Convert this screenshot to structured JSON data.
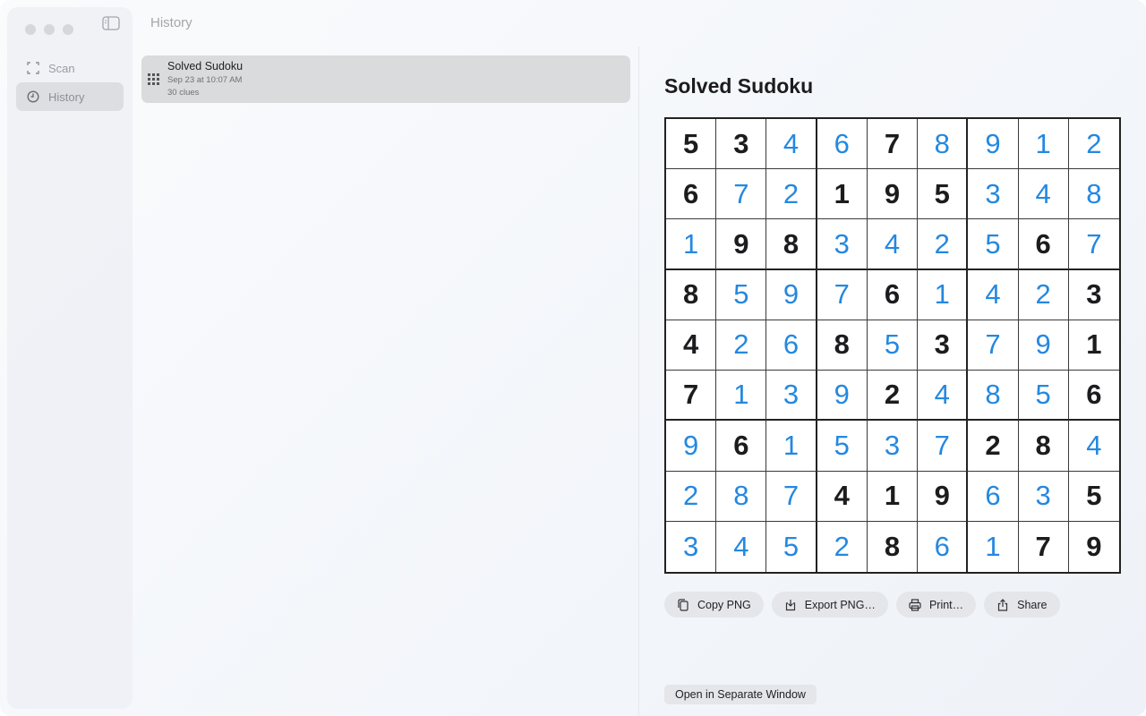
{
  "sidebar": {
    "items": [
      {
        "label": "Scan",
        "icon": "scan-icon"
      },
      {
        "label": "History",
        "icon": "clock-icon"
      }
    ]
  },
  "list": {
    "title": "History",
    "items": [
      {
        "title": "Solved Sudoku",
        "date": "Sep 23 at 10:07 AM",
        "clues": "30 clues",
        "icon": "grid-icon"
      }
    ]
  },
  "detail": {
    "title": "Solved Sudoku",
    "grid": [
      [
        "5",
        "3",
        "4",
        "6",
        "7",
        "8",
        "9",
        "1",
        "2"
      ],
      [
        "6",
        "7",
        "2",
        "1",
        "9",
        "5",
        "3",
        "4",
        "8"
      ],
      [
        "1",
        "9",
        "8",
        "3",
        "4",
        "2",
        "5",
        "6",
        "7"
      ],
      [
        "8",
        "5",
        "9",
        "7",
        "6",
        "1",
        "4",
        "2",
        "3"
      ],
      [
        "4",
        "2",
        "6",
        "8",
        "5",
        "3",
        "7",
        "9",
        "1"
      ],
      [
        "7",
        "1",
        "3",
        "9",
        "2",
        "4",
        "8",
        "5",
        "6"
      ],
      [
        "9",
        "6",
        "1",
        "5",
        "3",
        "7",
        "2",
        "8",
        "4"
      ],
      [
        "2",
        "8",
        "7",
        "4",
        "1",
        "9",
        "6",
        "3",
        "5"
      ],
      [
        "3",
        "4",
        "5",
        "2",
        "8",
        "6",
        "1",
        "7",
        "9"
      ]
    ],
    "given": [
      [
        1,
        1,
        0,
        0,
        1,
        0,
        0,
        0,
        0
      ],
      [
        1,
        0,
        0,
        1,
        1,
        1,
        0,
        0,
        0
      ],
      [
        0,
        1,
        1,
        0,
        0,
        0,
        0,
        1,
        0
      ],
      [
        1,
        0,
        0,
        0,
        1,
        0,
        0,
        0,
        1
      ],
      [
        1,
        0,
        0,
        1,
        0,
        1,
        0,
        0,
        1
      ],
      [
        1,
        0,
        0,
        0,
        1,
        0,
        0,
        0,
        1
      ],
      [
        0,
        1,
        0,
        0,
        0,
        0,
        1,
        1,
        0
      ],
      [
        0,
        0,
        0,
        1,
        1,
        1,
        0,
        0,
        1
      ],
      [
        0,
        0,
        0,
        0,
        1,
        0,
        0,
        1,
        1
      ]
    ],
    "colors": {
      "given": "#1c1c1e",
      "solved": "#2488e0"
    },
    "actions": [
      {
        "label": "Copy PNG",
        "icon": "copy-icon"
      },
      {
        "label": "Export PNG…",
        "icon": "export-icon"
      },
      {
        "label": "Print…",
        "icon": "printer-icon"
      },
      {
        "label": "Share",
        "icon": "share-icon"
      }
    ],
    "open_separate": "Open in Separate Window"
  }
}
